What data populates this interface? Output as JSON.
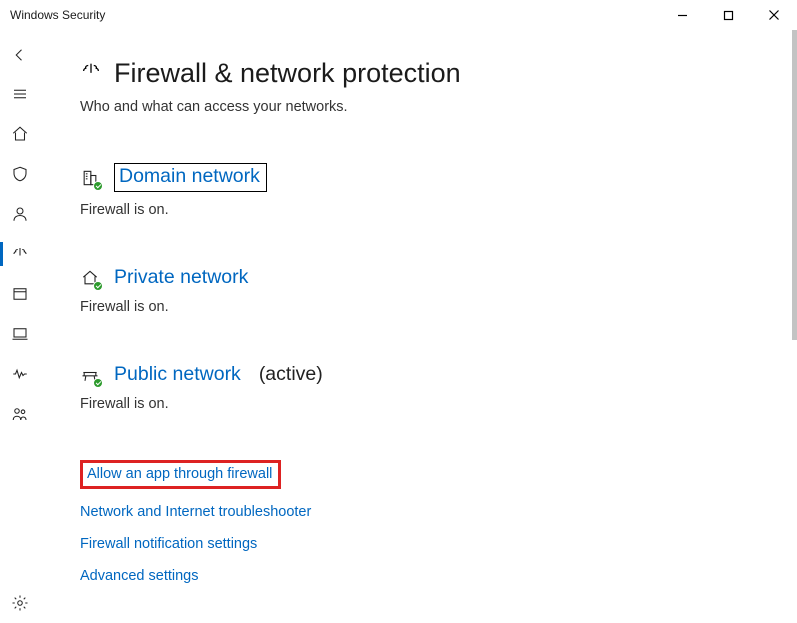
{
  "window": {
    "title": "Windows Security"
  },
  "page": {
    "title": "Firewall & network protection",
    "subtitle": "Who and what can access your networks."
  },
  "networks": {
    "domain": {
      "label": "Domain network",
      "status": "Firewall is on."
    },
    "private": {
      "label": "Private network",
      "status": "Firewall is on."
    },
    "public": {
      "label": "Public network",
      "active_tag": "(active)",
      "status": "Firewall is on."
    }
  },
  "links": {
    "allow_app": "Allow an app through firewall",
    "troubleshooter": "Network and Internet troubleshooter",
    "notification": "Firewall notification settings",
    "advanced": "Advanced settings"
  }
}
